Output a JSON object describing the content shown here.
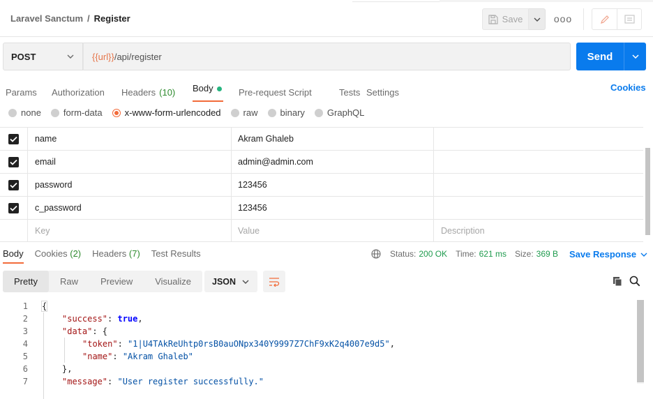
{
  "header": {
    "breadcrumb_parent": "Laravel Sanctum",
    "breadcrumb_separator": "/",
    "breadcrumb_current": "Register",
    "save_label": "Save",
    "more_label": "ooo"
  },
  "request": {
    "method": "POST",
    "url_variable": "{{url}}",
    "url_path": "/api/register",
    "send_label": "Send"
  },
  "request_tabs": [
    {
      "label": "Params"
    },
    {
      "label": "Authorization"
    },
    {
      "label": "Headers",
      "count": "(10)"
    },
    {
      "label": "Body"
    },
    {
      "label": "Pre-request Script"
    },
    {
      "label": "Tests"
    },
    {
      "label": "Settings"
    }
  ],
  "cookies_label": "Cookies",
  "body_types": [
    "none",
    "form-data",
    "x-www-form-urlencoded",
    "raw",
    "binary",
    "GraphQL"
  ],
  "body_type_selected": "x-www-form-urlencoded",
  "params": [
    {
      "key": "name",
      "value": "Akram Ghaleb"
    },
    {
      "key": "email",
      "value": "admin@admin.com"
    },
    {
      "key": "password",
      "value": "123456"
    },
    {
      "key": "c_password",
      "value": "123456"
    }
  ],
  "params_placeholder": {
    "key": "Key",
    "value": "Value",
    "description": "Description"
  },
  "response_tabs": [
    {
      "label": "Body"
    },
    {
      "label": "Cookies",
      "count": "(2)"
    },
    {
      "label": "Headers",
      "count": "(7)"
    },
    {
      "label": "Test Results"
    }
  ],
  "response_meta": {
    "status_label": "Status:",
    "status_value": "200 OK",
    "time_label": "Time:",
    "time_value": "621 ms",
    "size_label": "Size:",
    "size_value": "369 B"
  },
  "save_response_label": "Save Response",
  "view_modes": [
    "Pretty",
    "Raw",
    "Preview",
    "Visualize"
  ],
  "format": "JSON",
  "code_lines": [
    {
      "n": "1",
      "text": "{"
    },
    {
      "n": "2",
      "key": "\"success\"",
      "bool": "true",
      "tail": ","
    },
    {
      "n": "3",
      "key": "\"data\"",
      "tail": ": {"
    },
    {
      "n": "4",
      "key": "\"token\"",
      "str": "\"1|U4TAkReUhtp0rsB0auONpx340Y9997Z7ChF9xK2q4007e9d5\"",
      "tail": ","
    },
    {
      "n": "5",
      "key": "\"name\"",
      "str": "\"Akram Ghaleb\""
    },
    {
      "n": "6",
      "text": "},"
    },
    {
      "n": "7",
      "key": "\"message\"",
      "str": "\"User register successfully.\""
    }
  ],
  "colors": {
    "accent": "#097bed",
    "tab_indicator": "#f26b3a",
    "status_ok": "#1f9b4e",
    "url_variable": "#e6754a"
  }
}
